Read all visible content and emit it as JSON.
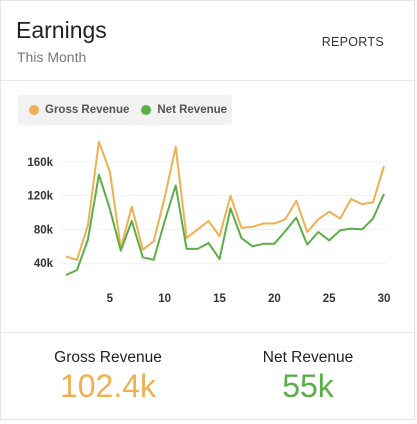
{
  "header": {
    "title": "Earnings",
    "subtitle": "This Month",
    "reports_label": "REPORTS"
  },
  "legend": {
    "gross_label": "Gross Revenue",
    "net_label": "Net Revenue"
  },
  "colors": {
    "gross": "#efb054",
    "net": "#5cae48"
  },
  "chart_data": {
    "type": "line",
    "x": [
      1,
      2,
      3,
      4,
      5,
      6,
      7,
      8,
      9,
      10,
      11,
      12,
      13,
      14,
      15,
      16,
      17,
      18,
      19,
      20,
      21,
      22,
      23,
      24,
      25,
      26,
      27,
      28,
      29,
      30
    ],
    "x_tick_labels": [
      "5",
      "10",
      "15",
      "20",
      "25",
      "30"
    ],
    "x_ticks": [
      5,
      10,
      15,
      20,
      25,
      30
    ],
    "y_tick_labels": [
      "40k",
      "80k",
      "120k",
      "160k"
    ],
    "y_ticks": [
      40000,
      80000,
      120000,
      160000
    ],
    "ylim": [
      0,
      180000
    ],
    "grid": true,
    "legend_position": "top-left",
    "series": [
      {
        "name": "Gross Revenue",
        "values": [
          48000,
          44000,
          85000,
          184000,
          148000,
          58000,
          107000,
          56000,
          66000,
          118000,
          178000,
          70000,
          80000,
          90000,
          72000,
          120000,
          82000,
          83000,
          87000,
          87000,
          92000,
          114000,
          77000,
          92000,
          101000,
          93000,
          116000,
          110000,
          112000,
          155000
        ]
      },
      {
        "name": "Net Revenue",
        "values": [
          26000,
          32000,
          68000,
          145000,
          104000,
          55000,
          90000,
          47000,
          44000,
          90000,
          132000,
          57000,
          57000,
          64000,
          45000,
          105000,
          70000,
          60000,
          63000,
          63000,
          78000,
          94000,
          62000,
          77000,
          67000,
          79000,
          81000,
          80000,
          93000,
          122000
        ]
      }
    ]
  },
  "footer": {
    "gross_label": "Gross Revenue",
    "gross_value": "102.4k",
    "net_label": "Net Revenue",
    "net_value": "55k"
  }
}
